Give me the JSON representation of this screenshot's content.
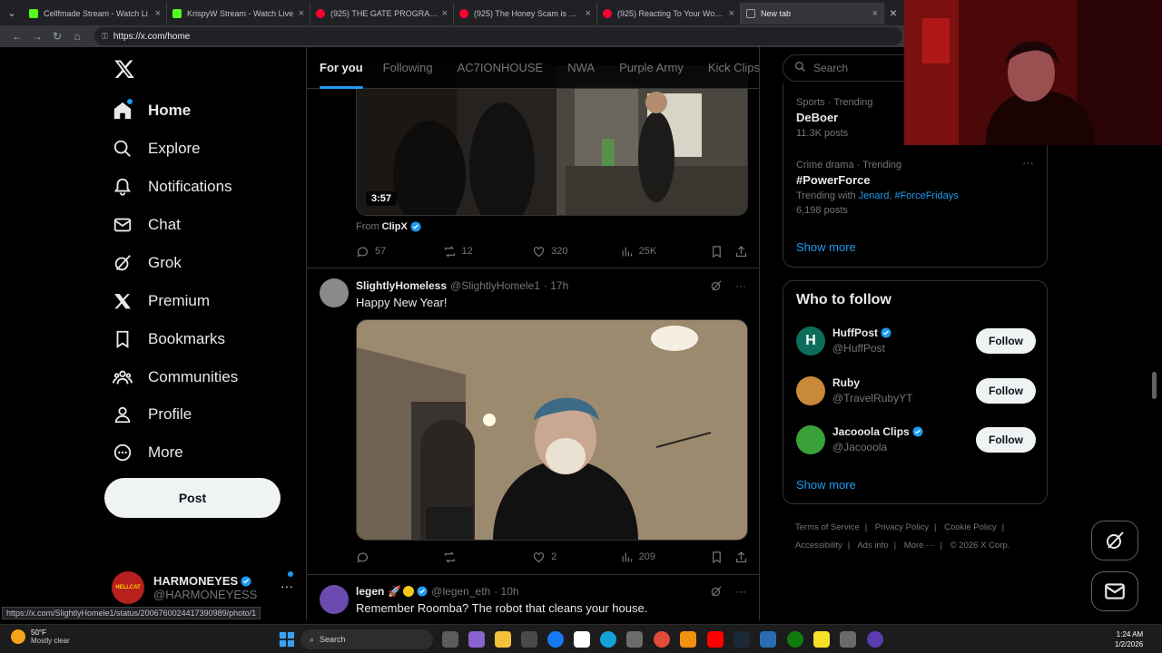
{
  "browser": {
    "tabs": [
      {
        "title": "Cellfmade Stream - Watch Li",
        "color": "#53fc18",
        "active": false
      },
      {
        "title": "KrispyW Stream - Watch Live",
        "color": "#53fc18",
        "active": false
      },
      {
        "title": "(925) THE GATE PROGRAM: Were",
        "color": "#ff0033",
        "active": false
      },
      {
        "title": "(925) The Honey Scam is Worse Th",
        "color": "#ff0033",
        "active": false
      },
      {
        "title": "(925) Reacting To Your Worst Tech",
        "color": "#ff0033",
        "active": false
      },
      {
        "title": "New tab",
        "color": "#9aa0a6",
        "active": true
      }
    ],
    "url": "https://x.com/home",
    "status_url": "https://x.com/SlightlyHomele1/status/2006760024417390989/photo/1"
  },
  "nav": {
    "items": [
      {
        "label": "Home",
        "icon": "home-icon"
      },
      {
        "label": "Explore",
        "icon": "search-icon"
      },
      {
        "label": "Notifications",
        "icon": "bell-icon"
      },
      {
        "label": "Chat",
        "icon": "mail-icon"
      },
      {
        "label": "Grok",
        "icon": "grok-icon"
      },
      {
        "label": "Premium",
        "icon": "x-icon"
      },
      {
        "label": "Bookmarks",
        "icon": "bookmark-icon"
      },
      {
        "label": "Communities",
        "icon": "communities-icon"
      },
      {
        "label": "Profile",
        "icon": "user-icon"
      },
      {
        "label": "More",
        "icon": "more-circle-icon"
      }
    ],
    "post_label": "Post",
    "account": {
      "name": "HARMONEYES",
      "handle": "@HARMONEYESS",
      "avatar_text": "HELLCAT"
    }
  },
  "timeline": {
    "tabs": [
      "For you",
      "Following",
      "AC7IONHOUSE",
      "NWA",
      "Purple Army",
      "Kick Clips"
    ],
    "video_post": {
      "duration": "3:57",
      "from_label": "From",
      "from_name": "ClipX",
      "replies": "57",
      "reposts": "12",
      "likes": "320",
      "views": "25K"
    },
    "post1": {
      "name": "SlightlyHomeless",
      "handle": "@SlightlyHomele1",
      "time": "· 17h",
      "text": "Happy New Year!",
      "replies": "",
      "reposts": "",
      "likes": "2",
      "views": "209"
    },
    "post2": {
      "name": "legen",
      "handle": "@legen_eth",
      "time": "· 10h",
      "text": "Remember Roomba? The robot that cleans your house."
    }
  },
  "right": {
    "search_placeholder": "Search",
    "trends": [
      {
        "meta": "Sports · Trending",
        "topic": "DeBoer",
        "count": "11.3K posts"
      },
      {
        "meta": "Crime drama · Trending",
        "topic": "#PowerForce",
        "with_label": "Trending with",
        "with_1": "Jenard",
        "with_2": "#ForceFridays",
        "count": "6,198 posts"
      }
    ],
    "show_more": "Show more",
    "who_to_follow": {
      "title": "Who to follow",
      "accounts": [
        {
          "name": "HuffPost",
          "handle": "@HuffPost",
          "verified": true,
          "avatar_color": "#0d6d5a",
          "avatar_text": "H"
        },
        {
          "name": "Ruby",
          "handle": "@TravelRubyYT",
          "verified": false,
          "avatar_color": "#c8893a",
          "avatar_text": ""
        },
        {
          "name": "Jacooola Clips",
          "handle": "@Jacooola",
          "verified": true,
          "avatar_color": "#3aa13a",
          "avatar_text": ""
        }
      ],
      "follow_label": "Follow",
      "show_more": "Show more"
    },
    "footer": [
      "Terms of Service",
      "|",
      "Privacy Policy",
      "|",
      "Cookie Policy",
      "|",
      "Accessibility",
      "|",
      "Ads info",
      "|",
      "More ···",
      "|",
      "© 2026 X Corp."
    ]
  },
  "taskbar": {
    "temp": "50°F",
    "weather": "Mostly clear",
    "search": "Search",
    "time": "1:24 AM",
    "date": "1/2/2026"
  },
  "colors": {
    "accent": "#1d9bf0",
    "background": "#000000",
    "border": "#2f3336",
    "muted": "#71767b"
  }
}
